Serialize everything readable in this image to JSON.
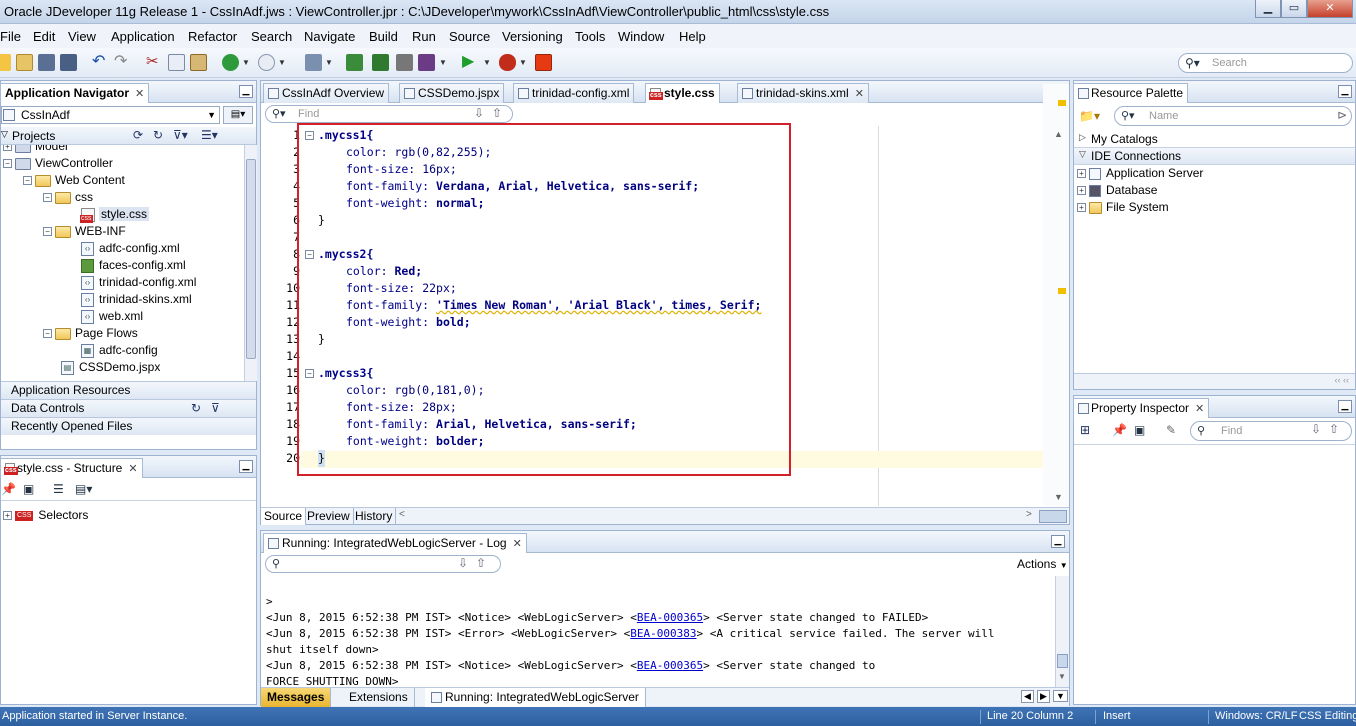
{
  "window": {
    "title": "Oracle JDeveloper 11g Release 1 - CssInAdf.jws : ViewController.jpr : C:\\JDeveloper\\mywork\\CssInAdf\\ViewController\\public_html\\css\\style.css",
    "minimize": "▁",
    "maximize": "▭",
    "close": "✕"
  },
  "menu": [
    "File",
    "Edit",
    "View",
    "Application",
    "Refactor",
    "Search",
    "Navigate",
    "Build",
    "Run",
    "Source",
    "Versioning",
    "Tools",
    "Window",
    "Help"
  ],
  "toolbar": {
    "search_placeholder": "Search"
  },
  "app_navigator": {
    "tab": "Application Navigator",
    "app_select": "CssInAdf",
    "projects_label": "Projects",
    "tree": {
      "model": "Model",
      "view_controller": "ViewController",
      "web_content": "Web Content",
      "css": "css",
      "style_css": "style.css",
      "web_inf": "WEB-INF",
      "adfc_config": "adfc-config.xml",
      "faces_config": "faces-config.xml",
      "trinidad_config": "trinidad-config.xml",
      "trinidad_skins": "trinidad-skins.xml",
      "web_xml": "web.xml",
      "page_flows": "Page Flows",
      "adfc_config_flow": "adfc-config",
      "cssdemo": "CSSDemo.jspx"
    },
    "sections": {
      "app_resources": "Application Resources",
      "data_controls": "Data Controls",
      "recent_files": "Recently Opened Files"
    }
  },
  "structure": {
    "tab": "style.css - Structure",
    "selectors": "Selectors"
  },
  "editor": {
    "tabs": [
      "CssInAdf Overview",
      "CSSDemo.jspx",
      "trinidad-config.xml",
      "style.css",
      "trinidad-skins.xml"
    ],
    "find_placeholder": "Find",
    "bottom_tabs": [
      "Source",
      "Preview",
      "History"
    ],
    "lines": {
      "l1": ".mycss1{",
      "l2_prop": "color:",
      "l2_val": "rgb(0,82,255);",
      "l3_prop": "font-size:",
      "l3_val": "16px;",
      "l4_prop": "font-family:",
      "l4_val": "Verdana, Arial, Helvetica, sans-serif;",
      "l5_prop": "font-weight:",
      "l5_val": "normal;",
      "l6": "}",
      "l8": ".mycss2{",
      "l9_prop": "color:",
      "l9_val": "Red;",
      "l10_prop": "font-size:",
      "l10_val": "22px;",
      "l11_prop": "font-family:",
      "l11_val": "'Times New Roman', 'Arial Black', times, Serif;",
      "l12_prop": "font-weight:",
      "l12_val": "bold;",
      "l13": "}",
      "l15": ".mycss3{",
      "l16_prop": "color:",
      "l16_val": "rgb(0,181,0);",
      "l17_prop": "font-size:",
      "l17_val": "28px;",
      "l18_prop": "font-family:",
      "l18_val": "Arial, Helvetica, sans-serif;",
      "l19_prop": "font-weight:",
      "l19_val": "bolder;",
      "l20": "}"
    },
    "line_numbers": [
      "1",
      "2",
      "3",
      "4",
      "5",
      "6",
      "7",
      "8",
      "9",
      "10",
      "11",
      "12",
      "13",
      "14",
      "15",
      "16",
      "17",
      "18",
      "19",
      "20"
    ]
  },
  "resource_palette": {
    "tab": "Resource Palette",
    "name_placeholder": "Name",
    "my_catalogs": "My Catalogs",
    "ide_connections": "IDE Connections",
    "app_server": "Application Server",
    "database": "Database",
    "file_system": "File System"
  },
  "property_inspector": {
    "tab": "Property Inspector",
    "find_placeholder": "Find"
  },
  "log": {
    "tab": "Running: IntegratedWebLogicServer - Log",
    "actions": "Actions",
    "lines": {
      "l0": ">",
      "l1a": "<Jun 8, 2015 6:52:38 PM IST> <Notice> <WebLogicServer> <",
      "l1link": "BEA-000365",
      "l1b": "> <Server state changed to FAILED>",
      "l2a": "<Jun 8, 2015 6:52:38 PM IST> <Error> <WebLogicServer> <",
      "l2link": "BEA-000383",
      "l2b": "> <A critical service failed. The server will",
      "l3": "shut itself down>",
      "l4a": "<Jun 8, 2015 6:52:38 PM IST> <Notice> <WebLogicServer> <",
      "l4link": "BEA-000365",
      "l4b": "> <Server state changed to",
      "l5": "FORCE_SHUTTING_DOWN>"
    },
    "bottom_tabs": [
      "Messages",
      "Extensions",
      "Running: IntegratedWebLogicServer"
    ]
  },
  "status": {
    "message": "Application started in Server Instance.",
    "position": "Line 20 Column 2",
    "mode": "Insert",
    "encoding": "Windows: CR/LF",
    "editing": "CSS Editing"
  }
}
